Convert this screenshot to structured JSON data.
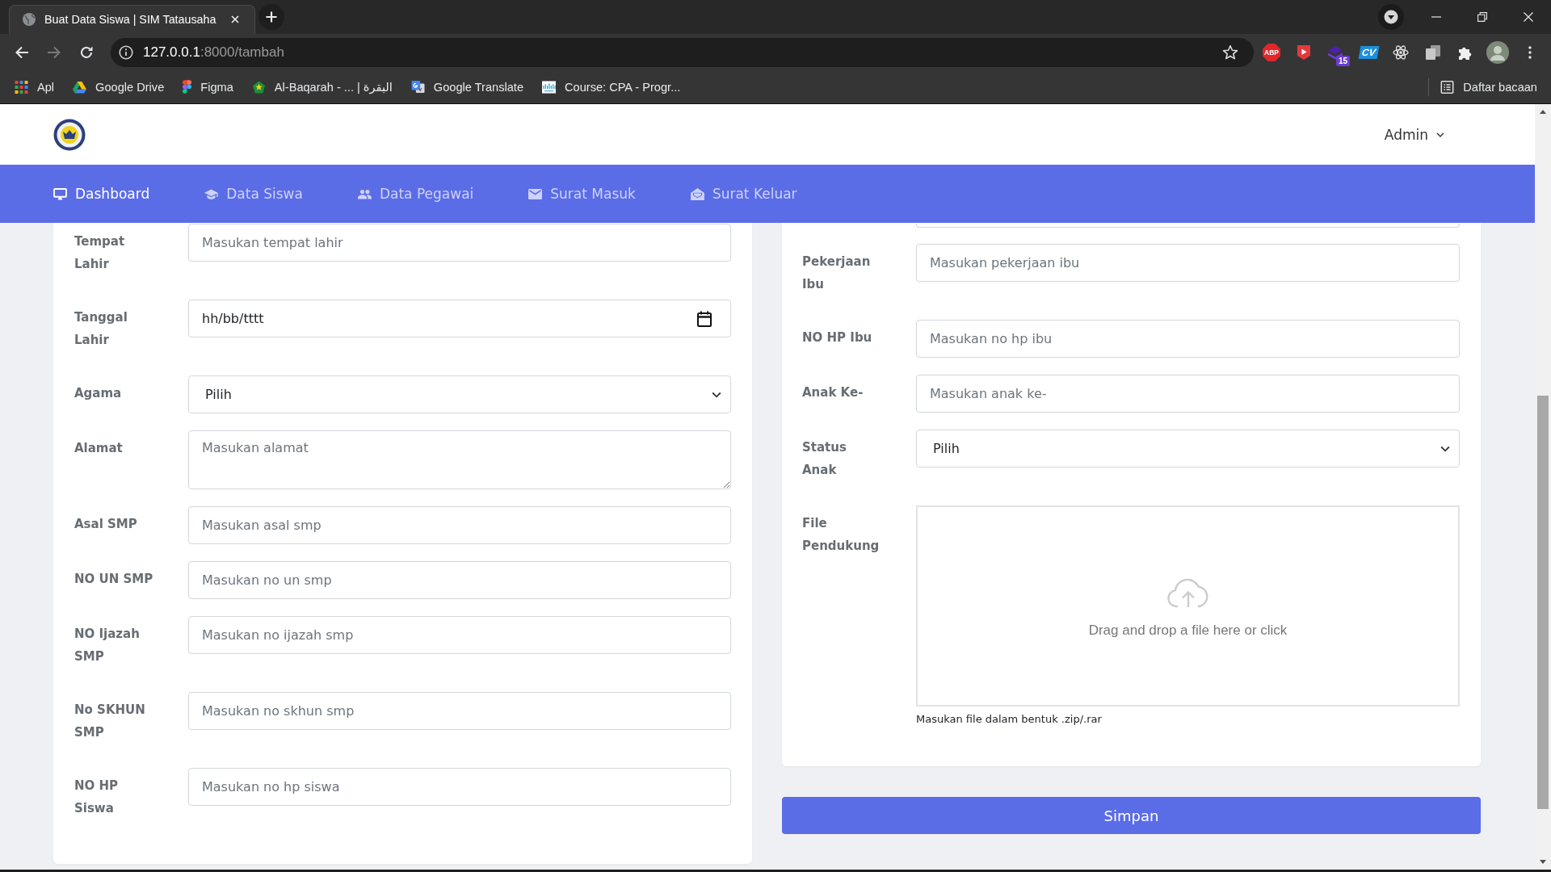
{
  "browser": {
    "tabs": [
      {
        "title": "Buat Data Siswa | SIM Tatausaha",
        "selected": true
      }
    ],
    "nav_buttons": [
      {
        "kind": "back",
        "disabled": false
      },
      {
        "kind": "forward",
        "disabled": true
      },
      {
        "kind": "reload",
        "disabled": false
      }
    ],
    "url": {
      "host": "127.0.0.1",
      "path": ":8000/tambah"
    },
    "toolbar_icons": [
      {
        "kind": "abp",
        "label": "ABP"
      },
      {
        "kind": "video"
      },
      {
        "kind": "stack",
        "badge": "15"
      },
      {
        "kind": "cv",
        "label": "CV"
      },
      {
        "kind": "atom"
      },
      {
        "kind": "copies"
      },
      {
        "kind": "puzzle"
      },
      {
        "kind": "avatar"
      }
    ],
    "bookmarks": [
      {
        "kind": "apps",
        "label": "Apl"
      },
      {
        "kind": "drive",
        "label": "Google Drive"
      },
      {
        "kind": "figma",
        "label": "Figma"
      },
      {
        "kind": "emblem",
        "label": "Al-Baqarah - ... | البقرة"
      },
      {
        "kind": "translate",
        "label": "Google Translate"
      },
      {
        "kind": "cisco",
        "label": "Course: CPA - Progr..."
      }
    ],
    "reading_list": "Daftar bacaan"
  },
  "header": {
    "user": "Admin"
  },
  "nav": [
    {
      "kind": "monitor",
      "label": "Dashboard",
      "selected": true
    },
    {
      "kind": "cap",
      "label": "Data Siswa",
      "selected": false
    },
    {
      "kind": "people",
      "label": "Data Pegawai",
      "selected": false
    },
    {
      "kind": "envelope",
      "label": "Surat Masuk",
      "selected": false
    },
    {
      "kind": "envelope-open",
      "label": "Surat Keluar",
      "selected": false
    }
  ],
  "left_form": {
    "fields": [
      {
        "kind": "text",
        "label": "Tempat Lahir",
        "placeholder": "Masukan tempat lahir"
      },
      {
        "kind": "date",
        "label": "Tanggal Lahir",
        "placeholder": "hh/bb/tttt"
      },
      {
        "kind": "select",
        "label": "Agama",
        "value": "Pilih"
      },
      {
        "kind": "textarea",
        "label": "Alamat",
        "placeholder": "Masukan alamat"
      },
      {
        "kind": "text",
        "label": "Asal SMP",
        "placeholder": "Masukan asal smp"
      },
      {
        "kind": "text",
        "label": "NO UN SMP",
        "placeholder": "Masukan no un smp"
      },
      {
        "kind": "text",
        "label": "NO Ijazah SMP",
        "placeholder": "Masukan no ijazah smp"
      },
      {
        "kind": "text",
        "label": "No SKHUN SMP",
        "placeholder": "Masukan no skhun smp"
      },
      {
        "kind": "text",
        "label": "NO HP Siswa",
        "placeholder": "Masukan no hp siswa"
      }
    ]
  },
  "right_form": {
    "fields": [
      {
        "kind": "clipped"
      },
      {
        "kind": "text",
        "label": "Pekerjaan Ibu",
        "placeholder": "Masukan pekerjaan ibu"
      },
      {
        "kind": "text",
        "label": "NO HP Ibu",
        "placeholder": "Masukan no hp ibu"
      },
      {
        "kind": "text",
        "label": "Anak Ke-",
        "placeholder": "Masukan anak ke-"
      },
      {
        "kind": "select",
        "label": "Status Anak",
        "value": "Pilih"
      },
      {
        "kind": "file",
        "label": "File Pendukung",
        "prompt": "Drag and drop a file here or click",
        "help": "Masukan file dalam bentuk .zip/.rar"
      }
    ]
  },
  "submit": "Simpan"
}
